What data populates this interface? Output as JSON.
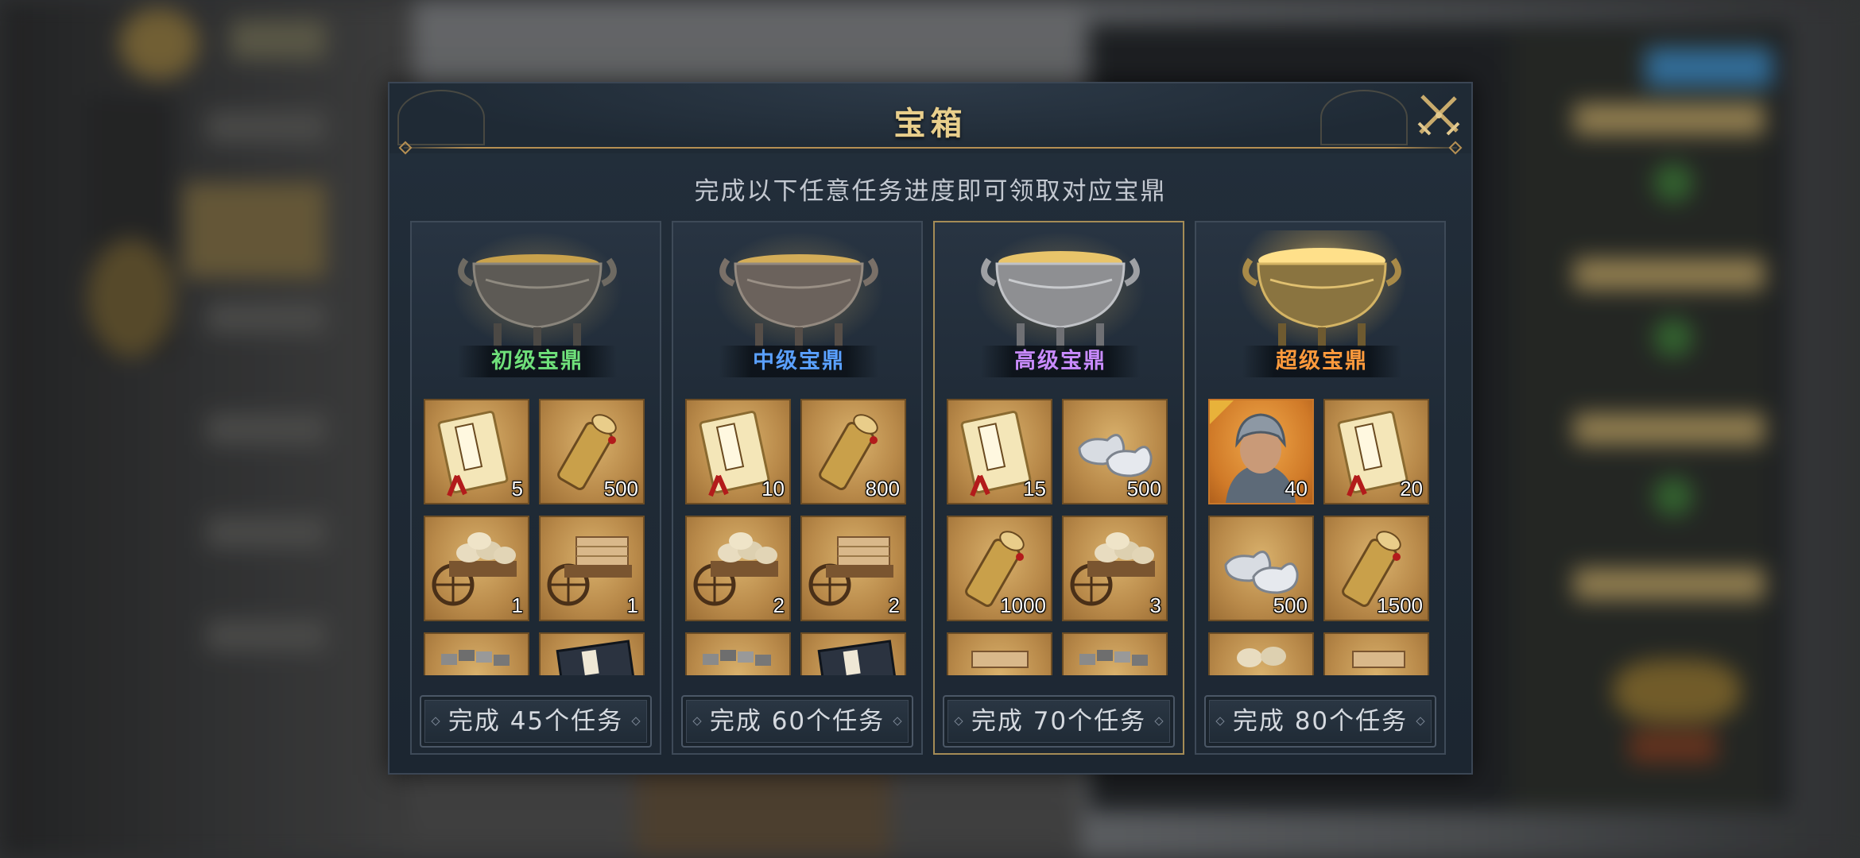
{
  "dialog": {
    "title": "宝箱",
    "subtitle": "完成以下任意任务进度即可领取对应宝鼎"
  },
  "cards": [
    {
      "name": "初级宝鼎",
      "name_color": "#6fe07a",
      "button": "完成 45个任务",
      "items": [
        {
          "icon": "recruit-order-book-icon",
          "qty": "5"
        },
        {
          "icon": "telescope-scroll-icon",
          "qty": "500"
        },
        {
          "icon": "grain-cart-icon",
          "qty": "1"
        },
        {
          "icon": "timber-cart-icon",
          "qty": "1"
        },
        {
          "icon": "iron-ore-cart-icon",
          "qty": ""
        },
        {
          "icon": "book-icon",
          "qty": ""
        }
      ]
    },
    {
      "name": "中级宝鼎",
      "name_color": "#5aa0ff",
      "button": "完成 60个任务",
      "items": [
        {
          "icon": "recruit-order-book-icon",
          "qty": "10"
        },
        {
          "icon": "telescope-scroll-icon",
          "qty": "800"
        },
        {
          "icon": "grain-cart-icon",
          "qty": "2"
        },
        {
          "icon": "timber-cart-icon",
          "qty": "2"
        },
        {
          "icon": "iron-ore-cart-icon",
          "qty": ""
        },
        {
          "icon": "book-icon",
          "qty": ""
        }
      ]
    },
    {
      "name": "高级宝鼎",
      "name_color": "#c98bff",
      "button": "完成 70个任务",
      "selected": true,
      "items": [
        {
          "icon": "recruit-order-book-icon",
          "qty": "15"
        },
        {
          "icon": "silver-ingot-icon",
          "qty": "500"
        },
        {
          "icon": "telescope-scroll-icon",
          "qty": "1000"
        },
        {
          "icon": "grain-cart-icon",
          "qty": "3"
        },
        {
          "icon": "timber-cart-icon",
          "qty": ""
        },
        {
          "icon": "iron-ore-cart-icon",
          "qty": ""
        }
      ]
    },
    {
      "name": "超级宝鼎",
      "name_color": "#ff9a3c",
      "button": "完成 80个任务",
      "items": [
        {
          "icon": "general-portrait-icon",
          "qty": "40",
          "orange": true
        },
        {
          "icon": "recruit-order-book-icon",
          "qty": "20"
        },
        {
          "icon": "silver-ingot-icon",
          "qty": "500"
        },
        {
          "icon": "telescope-scroll-icon",
          "qty": "1500"
        },
        {
          "icon": "grain-cart-icon",
          "qty": ""
        },
        {
          "icon": "timber-cart-icon",
          "qty": ""
        }
      ]
    }
  ],
  "colors": {
    "title": "#e9cf8c",
    "frame_gold": "#b58f53",
    "panel_bg": "#1f2a35"
  }
}
